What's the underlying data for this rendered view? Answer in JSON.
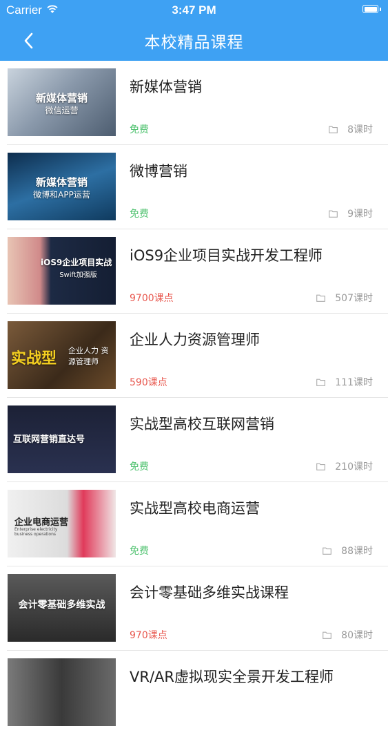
{
  "status_bar": {
    "carrier": "Carrier",
    "time": "3:47 PM"
  },
  "nav": {
    "title": "本校精品课程"
  },
  "courses": [
    {
      "title": "新媒体营销",
      "price": "免费",
      "price_type": "free",
      "hours": "8课时",
      "thumb_title": "新媒体营销",
      "thumb_sub": "微信运营",
      "thumb_bg": "#6c7f96"
    },
    {
      "title": "微博营销",
      "price": "免费",
      "price_type": "free",
      "hours": "9课时",
      "thumb_title": "新媒体营销",
      "thumb_sub": "微博和APP运营",
      "thumb_bg": "#1b4f7a"
    },
    {
      "title": "iOS9企业项目实战开发工程师",
      "price": "9700课点",
      "price_type": "paid",
      "hours": "507课时",
      "thumb_title": "iOS9企业项目实战",
      "thumb_sub": "Swift加强版",
      "thumb_bg": "#1d2a44"
    },
    {
      "title": "企业人力资源管理师",
      "price": "590课点",
      "price_type": "paid",
      "hours": "111课时",
      "thumb_title": "实战型",
      "thumb_sub": "企业人力 资源管理师",
      "thumb_bg": "#4a3320"
    },
    {
      "title": "实战型高校互联网营销",
      "price": "免费",
      "price_type": "free",
      "hours": "210课时",
      "thumb_title": "互联网营销直达号",
      "thumb_sub": "",
      "thumb_bg": "#1c2136"
    },
    {
      "title": "实战型高校电商运营",
      "price": "免费",
      "price_type": "free",
      "hours": "88课时",
      "thumb_title": "企业电商运营",
      "thumb_sub": "Enterprise electricity business operations",
      "thumb_bg": "#e9e9e9"
    },
    {
      "title": "会计零基础多维实战课程",
      "price": "970课点",
      "price_type": "paid",
      "hours": "80课时",
      "thumb_title": "会计零基础多维实战",
      "thumb_sub": "",
      "thumb_bg": "#3a3a3a"
    },
    {
      "title": "VR/AR虚拟现实全景开发工程师",
      "price": "",
      "price_type": "paid",
      "hours": "",
      "thumb_title": "",
      "thumb_sub": "",
      "thumb_bg": "#5a5a5a"
    }
  ],
  "icons": {
    "back": "chevron-left-icon",
    "hours": "folder-icon",
    "wifi": "wifi-icon",
    "battery": "battery-icon"
  },
  "colors": {
    "nav_bg": "#3ea1f3",
    "free": "#4fc26f",
    "paid": "#e8584f"
  }
}
